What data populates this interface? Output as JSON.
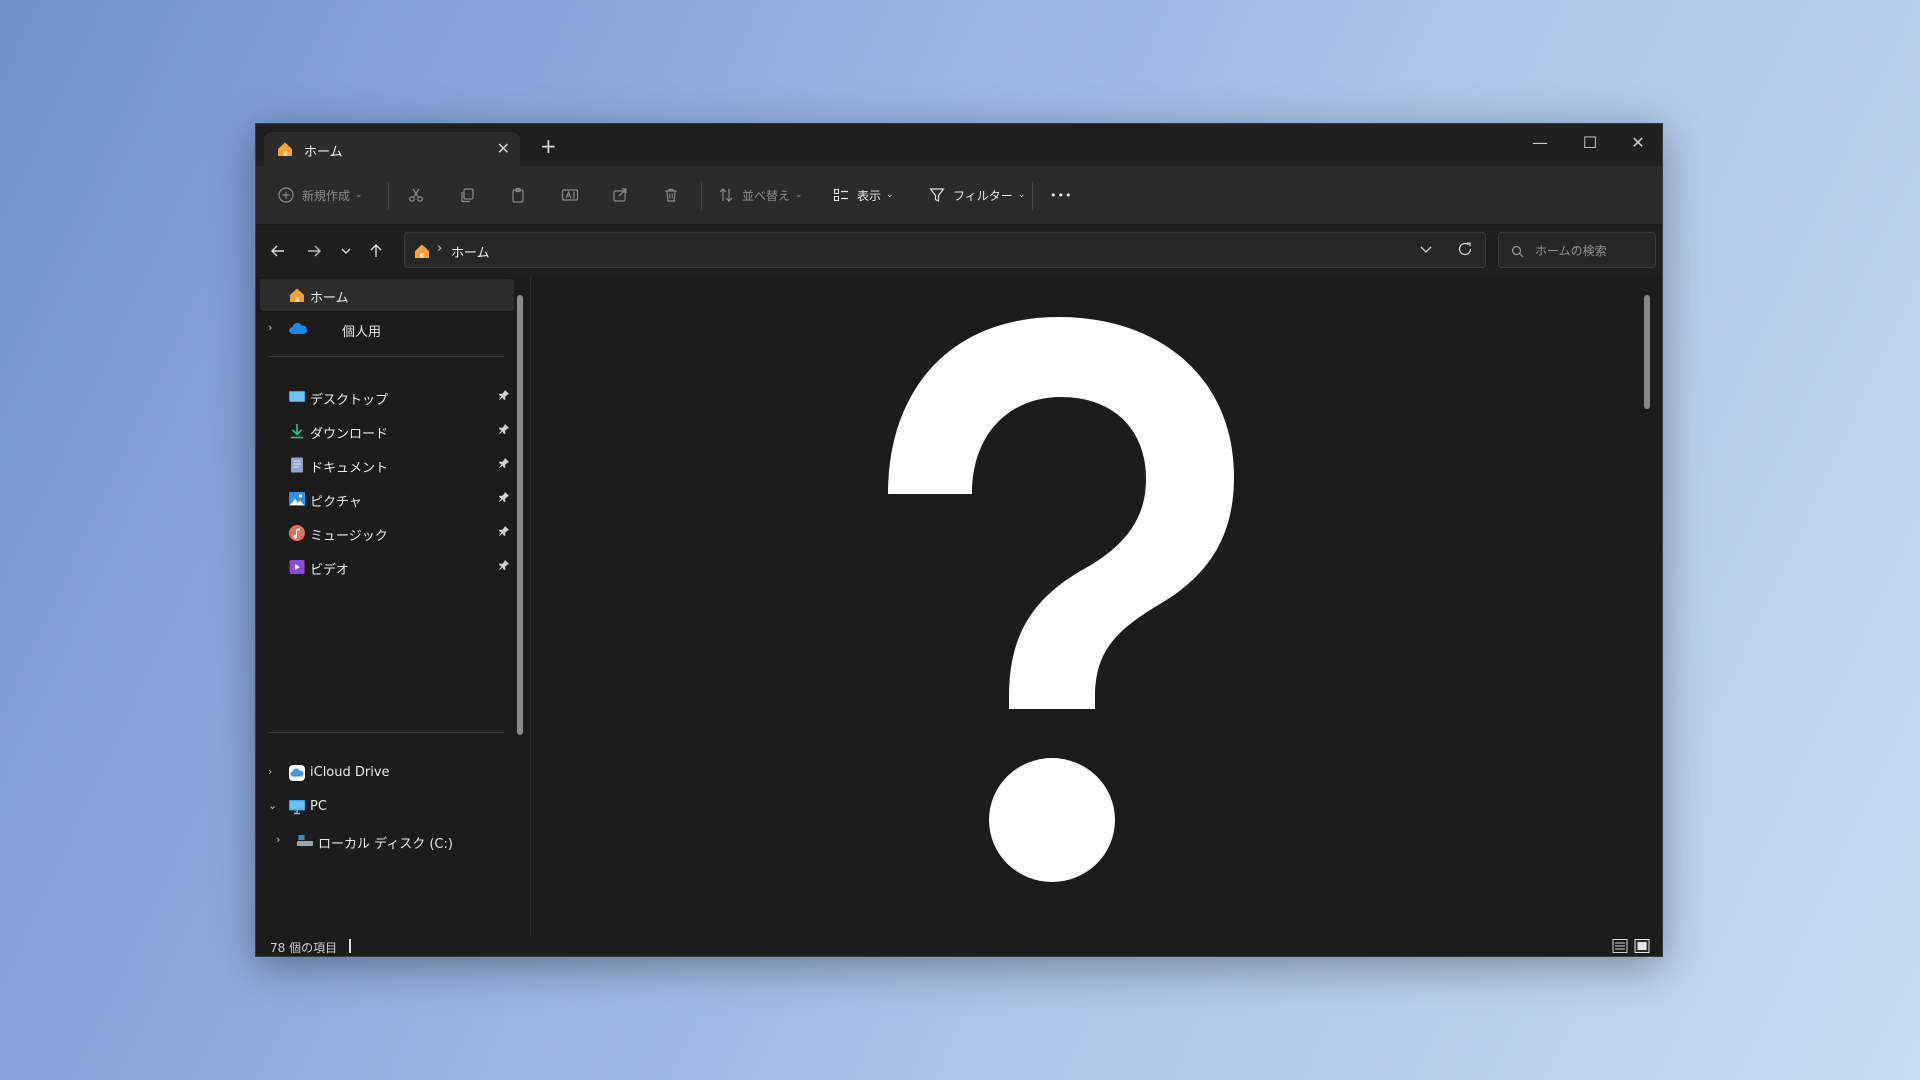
{
  "tab": {
    "title": "ホーム",
    "close_glyph": "✕"
  },
  "titlebar": {
    "new_tab_glyph": "+",
    "minimize_glyph": "—",
    "maximize_glyph": "☐",
    "close_glyph": "✕"
  },
  "toolbar": {
    "new_label": "新規作成",
    "sort_label": "並べ替え",
    "view_label": "表示",
    "filter_label": "フィルター",
    "more_glyph": "•••",
    "chevron_glyph": "⌄"
  },
  "address": {
    "crumb_separator": "›",
    "crumb": "ホーム"
  },
  "search": {
    "placeholder": "ホームの検索"
  },
  "sidebar": {
    "home": "ホーム",
    "onedrive": "個人用",
    "expand_glyph": "›",
    "expanded_glyph": "⌄",
    "quick_access": [
      {
        "label": "デスクトップ",
        "icon": "desktop-folder-icon"
      },
      {
        "label": "ダウンロード",
        "icon": "download-icon"
      },
      {
        "label": "ドキュメント",
        "icon": "document-icon"
      },
      {
        "label": "ピクチャ",
        "icon": "picture-icon"
      },
      {
        "label": "ミュージック",
        "icon": "music-icon"
      },
      {
        "label": "ビデオ",
        "icon": "video-icon"
      }
    ],
    "icloud": "iCloud Drive",
    "pc": "PC",
    "local_disk": "ローカル ディスク (C:)"
  },
  "content": {
    "placeholder_icon": "question-mark-icon"
  },
  "status": {
    "item_count": "78 個の項目"
  },
  "colors": {
    "window_bg": "#1c1c1c",
    "toolbar_bg": "#2b2b2b",
    "accent_home": "#f0a030"
  }
}
